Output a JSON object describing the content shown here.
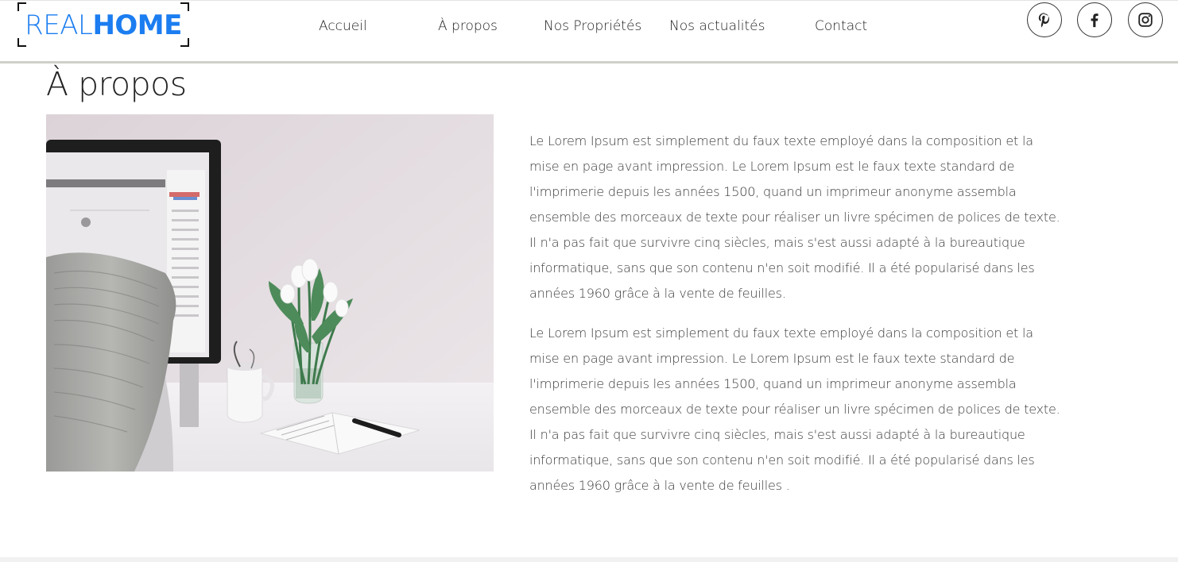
{
  "brand": {
    "logo_light": "REAL",
    "logo_bold": "HOME",
    "accent_color": "#1b7df0"
  },
  "nav": {
    "items": [
      {
        "label": "Accueil"
      },
      {
        "label": "À propos"
      },
      {
        "label": "Nos Propriétés"
      },
      {
        "label": "Nos actualités"
      },
      {
        "label": "Contact"
      }
    ]
  },
  "social": {
    "icons": [
      "pinterest-icon",
      "facebook-icon",
      "instagram-icon"
    ]
  },
  "main": {
    "title": "À propos",
    "image_subject": "desk with monitor, tulips in glass vase, mug and open notebook",
    "paragraphs": [
      "Le Lorem Ipsum est simplement du faux texte employé dans la composition et la mise en page avant impression. Le Lorem Ipsum est le faux texte standard de l'imprimerie depuis les années 1500, quand un imprimeur anonyme assembla ensemble des morceaux de texte pour réaliser un livre spécimen de polices de texte. Il n'a pas fait que survivre cinq siècles, mais s'est aussi adapté à la bureautique informatique, sans que son contenu n'en soit modifié. Il a été popularisé dans les années 1960 grâce à la vente de feuilles.",
      "Le Lorem Ipsum est simplement du faux texte employé dans la composition et la mise en page avant impression. Le Lorem Ipsum est le faux texte standard de l'imprimerie depuis les années 1500, quand un imprimeur anonyme assembla ensemble des morceaux de texte pour réaliser un livre spécimen de polices de texte. Il n'a pas fait que survivre cinq siècles, mais s'est aussi adapté à la bureautique informatique, sans que son contenu n'en soit modifié. Il a été popularisé dans les années 1960 grâce à la vente de feuilles ."
    ]
  }
}
